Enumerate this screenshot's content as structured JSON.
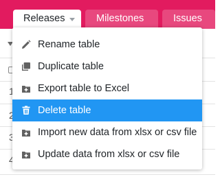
{
  "tabs": [
    {
      "label": "Releases",
      "active": true
    },
    {
      "label": "Milestones",
      "active": false
    },
    {
      "label": "Issues",
      "active": false
    }
  ],
  "table_menu": {
    "items": [
      {
        "label": "Rename table",
        "icon": "pencil-icon"
      },
      {
        "label": "Duplicate table",
        "icon": "copy-icon"
      },
      {
        "label": "Export table to Excel",
        "icon": "export-icon"
      },
      {
        "label": "Delete table",
        "icon": "trash-icon",
        "highlighted": true
      },
      {
        "label": "Import new data from xlsx or csv file",
        "icon": "import-icon"
      },
      {
        "label": "Update data from xlsx or csv file",
        "icon": "update-icon"
      }
    ]
  },
  "background_rows": [
    "1",
    "2",
    "3",
    "4"
  ],
  "colors": {
    "header_bg": "#e21b5f",
    "inactive_tab_bg": "#e8487e",
    "highlight": "#2196f3",
    "icon_gray": "#616161"
  }
}
